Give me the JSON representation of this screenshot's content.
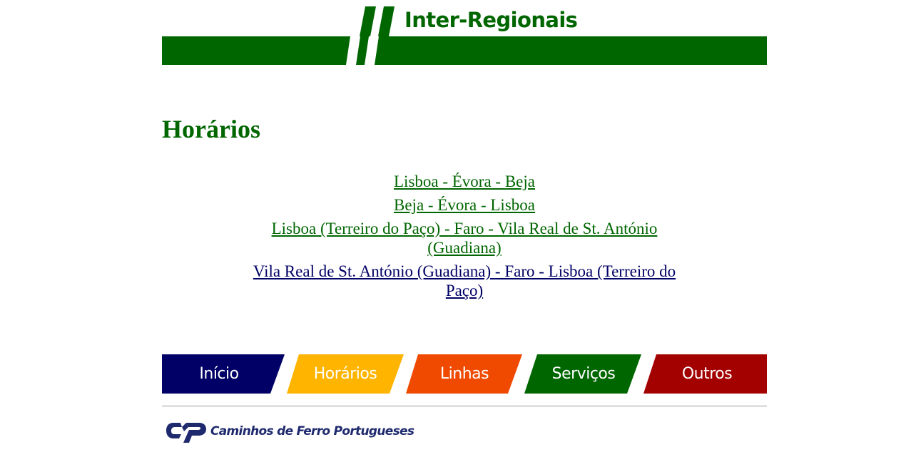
{
  "banner": {
    "title": "Inter-Regionais"
  },
  "heading": "Horários",
  "links": [
    {
      "label": "Lisboa - Évora - Beja"
    },
    {
      "label": "Beja - Évora - Lisboa"
    },
    {
      "label": "Lisboa (Terreiro do Paço) - Faro - Vila Real de St. António (Guadiana)"
    },
    {
      "label": "Vila Real de St. António (Guadiana) - Faro - Lisboa (Terreiro do Paço)"
    }
  ],
  "nav": [
    {
      "label": "Início",
      "color": "#000066"
    },
    {
      "label": "Horários",
      "color": "#FFB400"
    },
    {
      "label": "Linhas",
      "color": "#F04A00"
    },
    {
      "label": "Serviços",
      "color": "#006600"
    },
    {
      "label": "Outros",
      "color": "#A30000"
    }
  ],
  "footer": {
    "logo_text": "Caminhos de Ferro Portugueses"
  },
  "colors": {
    "brand_green": "#006600",
    "visited_link": "#000066",
    "logo_blue": "#1F2A6E"
  }
}
